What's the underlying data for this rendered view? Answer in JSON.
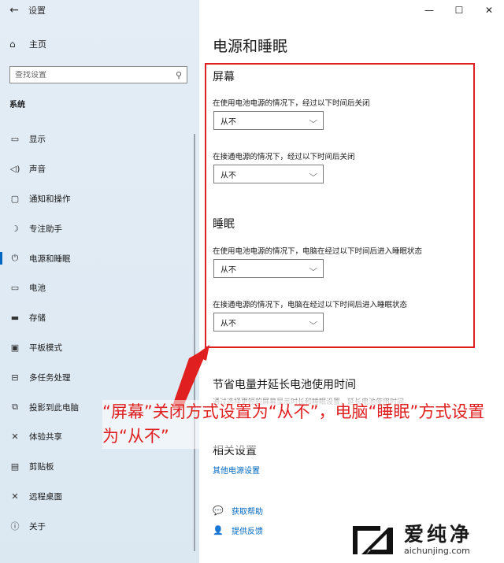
{
  "window": {
    "title": "设置",
    "back_glyph": "←",
    "min_glyph": "—",
    "max_glyph": "☐",
    "close_glyph": "✕"
  },
  "sidebar": {
    "home_label": "主页",
    "search_placeholder": "查找设置",
    "section_label": "系统",
    "items": [
      {
        "label": "显示",
        "icon": "monitor-icon",
        "glyph": "▭"
      },
      {
        "label": "声音",
        "icon": "speaker-icon",
        "glyph": "◁)"
      },
      {
        "label": "通知和操作",
        "icon": "notification-icon",
        "glyph": "▢"
      },
      {
        "label": "专注助手",
        "icon": "moon-icon",
        "glyph": "☽"
      },
      {
        "label": "电源和睡眠",
        "icon": "power-icon",
        "glyph": "⏻",
        "active": true
      },
      {
        "label": "电池",
        "icon": "battery-icon",
        "glyph": "▭"
      },
      {
        "label": "存储",
        "icon": "storage-icon",
        "glyph": "▬"
      },
      {
        "label": "平板模式",
        "icon": "tablet-icon",
        "glyph": "▣"
      },
      {
        "label": "多任务处理",
        "icon": "multitask-icon",
        "glyph": "⊟"
      },
      {
        "label": "投影到此电脑",
        "icon": "project-icon",
        "glyph": "⧉"
      },
      {
        "label": "体验共享",
        "icon": "share-icon",
        "glyph": "✕"
      },
      {
        "label": "剪贴板",
        "icon": "clipboard-icon",
        "glyph": "▤"
      },
      {
        "label": "远程桌面",
        "icon": "remote-desktop-icon",
        "glyph": "✕"
      },
      {
        "label": "关于",
        "icon": "info-icon",
        "glyph": "ⓘ"
      }
    ]
  },
  "main": {
    "title": "电源和睡眠",
    "screen": {
      "heading": "屏幕",
      "battery_desc": "在使用电池电源的情况下，经过以下时间后关闭",
      "battery_value": "从不",
      "plugged_desc": "在接通电源的情况下，经过以下时间后关闭",
      "plugged_value": "从不"
    },
    "sleep": {
      "heading": "睡眠",
      "battery_desc": "在使用电池电源的情况下，电脑在经过以下时间后进入睡眠状态",
      "battery_value": "从不",
      "plugged_desc": "在接通电源的情况下，电脑在经过以下时间后进入睡眠状态",
      "plugged_value": "从不"
    },
    "save_power_heading": "节省电量并延长电池使用时间",
    "save_power_desc": "通过选择更短的屏幕显示时长和睡眠设置，延长电池使用时间。",
    "related_heading": "相关设置",
    "related_link": "其他电源设置",
    "get_help": "获取帮助",
    "feedback": "提供反馈"
  },
  "annotation": {
    "text": "“屏幕”关闭方式设置为“从不”，电脑“睡眠”方式设置为“从不”",
    "color": "#e02020"
  },
  "watermark": {
    "cn": "爱纯净",
    "en": "aichunjing.com"
  },
  "colors": {
    "accent": "#0067c0",
    "highlight": "#e02020"
  }
}
